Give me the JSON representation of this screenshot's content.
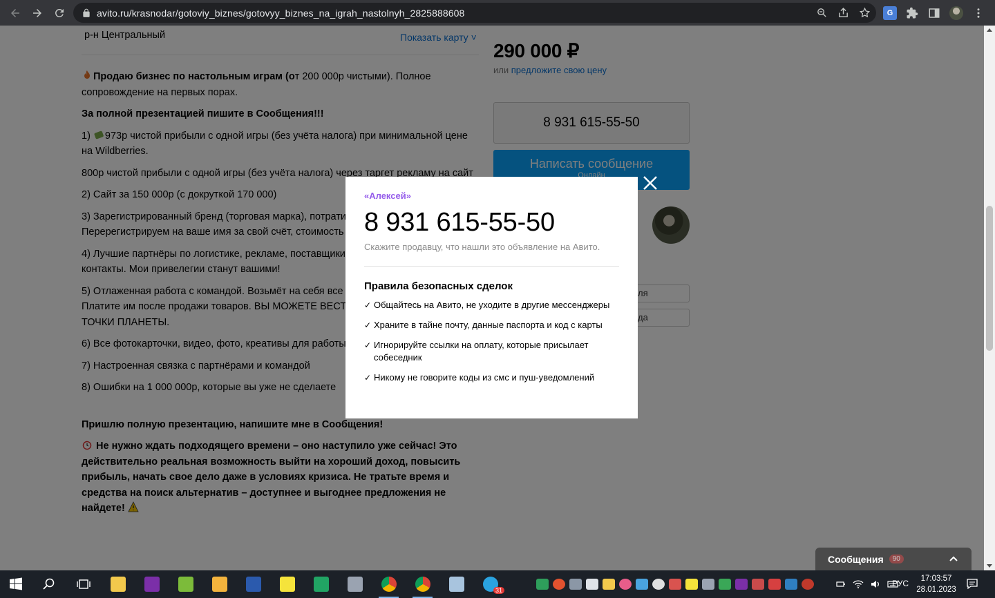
{
  "browser": {
    "url": "avito.ru/krasnodar/gotoviy_biznes/gotovyy_biznes_na_igrah_nastolnyh_2825888608"
  },
  "listing": {
    "district": "р-н Центральный",
    "show_map": "Показать карту",
    "description": {
      "intro_bold": "Продаю бизнес по настольным играм (о",
      "intro_rest": "т 200 000р чистыми). Полное сопровождение на первых порах.",
      "cta_bold": "За полной презентацией пишите в Сообщения!!!",
      "p1": "973р чистой прибыли с одной игры (без учёта налога) при минимальной цене на Wildberries.",
      "p1_prefix": "1) ",
      "p2": " 800р чистой прибыли с одной игры (без учёта налога) через таргет рекламу на сайт",
      "p3": " 2) Сайт за 150 000р (с докруткой 170 000)",
      "p4": " 3) Зарегистрированный бренд (торговая марка), потрати",
      "p4b": "Перерегистрируем на ваше имя за свой счёт, стоимость",
      "p5": "4) Лучшие партнёры по логистике, рекламе, поставщики",
      "p5b": "контакты. Мои привелегии станут вашими!",
      "p6": "5) Отлаженная работа с командой. Возьмёт на себя все",
      "p6b": "Платите им после продажи товаров. ВЫ МОЖЕТЕ ВЕСТ",
      "p6c": "ТОЧКИ ПЛАНЕТЫ.",
      "p7": "6) Все фотокарточки, видео, фото, креативы для работы",
      "p8": "7) Настроенная связка с партнёрами и командой",
      "p9": "8) Ошибки на 1 000 000р, которые вы уже не сделаете",
      "closing_bold": "Пришлю полную презентацию, напишите мне в Сообщения!",
      "final_bold": "Не нужно ждать подходящего времени – оно наступило уже сейчас! Это действительно реальная возможность выйти на хороший доход, повысить прибыль, начать свое дело даже в условиях кризиса. Не тратьте время и средства на поиск альтернатив – доступнее и выгоднее предложения не найдете!"
    },
    "price": "290 000 ₽",
    "price_or": "или",
    "price_offer": "предложите свою цену",
    "phone": "8 931 615-55-50",
    "message_button": "Написать сообщение",
    "online": "Онлайн",
    "side_btn_1": "ля",
    "side_btn_2": "да"
  },
  "modal": {
    "seller_name": "«Алексей»",
    "phone": "8 931 615-55-50",
    "hint": "Скажите продавцу, что нашли это объявление на Авито.",
    "rules_title": "Правила безопасных сделок",
    "rules": [
      "Общайтесь на Авито, не уходите в другие мессенджеры",
      "Храните в тайне почту, данные паспорта и код с карты",
      "Игнорируйте ссылки на оплату, которые присылает собеседник",
      "Никому не говорите коды из смс и пуш-уведомлений"
    ]
  },
  "messages_panel": {
    "label": "Сообщения",
    "count": "90"
  },
  "taskbar": {
    "language": "РУС",
    "time": "17:03:57",
    "date": "28.01.2023",
    "telegram_badge": "31"
  }
}
